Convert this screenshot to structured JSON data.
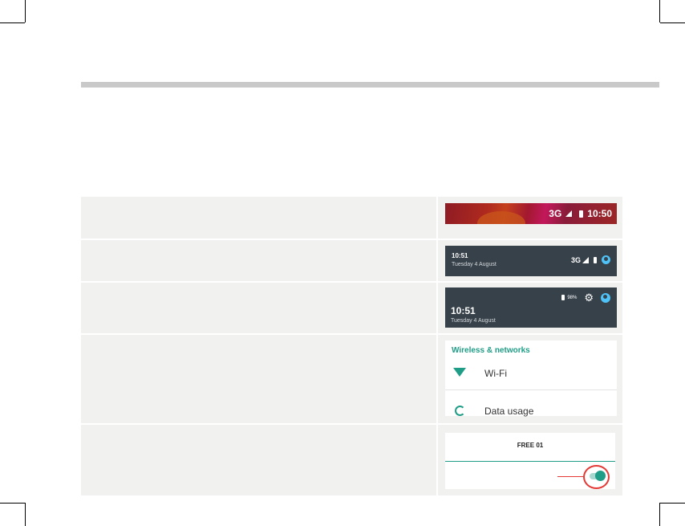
{
  "panels": {
    "status_bar": {
      "network": "3G",
      "time": "10:50"
    },
    "notification_shade": {
      "time": "10:51",
      "date": "Tuesday 4 August",
      "network": "3G"
    },
    "quick_settings": {
      "battery": "98%",
      "time": "10:51",
      "date": "Tuesday 4 August"
    },
    "settings": {
      "header": "Wireless & networks",
      "wifi_label": "Wi-Fi",
      "data_label": "Data usage"
    },
    "wifi_network": {
      "ssid": "FREE 01",
      "toggle_state": "on"
    }
  },
  "colors": {
    "accent": "#1f9d86",
    "highlight": "#e53935",
    "shade": "#37414a"
  },
  "icons": [
    "signal-icon",
    "battery-icon",
    "avatar-icon",
    "gear-icon",
    "wifi-icon",
    "data-usage-icon",
    "toggle-switch"
  ]
}
